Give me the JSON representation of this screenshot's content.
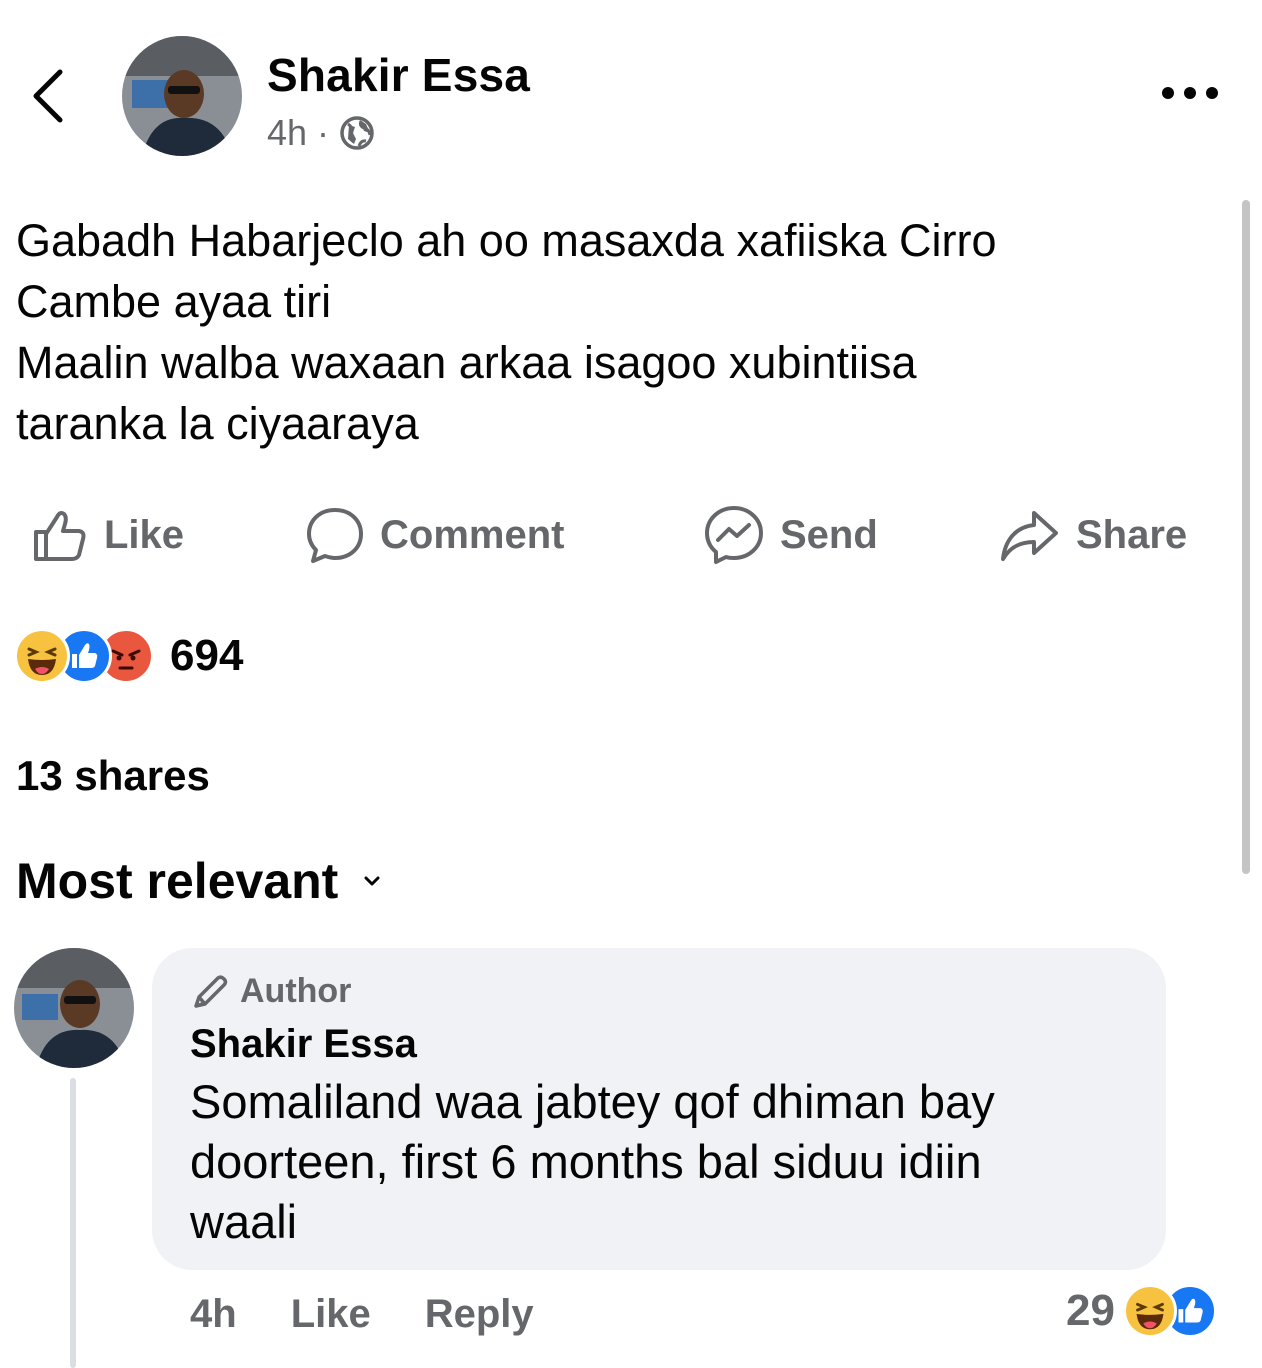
{
  "post": {
    "author": "Shakir Essa",
    "time": "4h",
    "separator": "·",
    "audience_icon": "globe-icon",
    "text_lines": [
      "Gabadh Habarjeclo ah oo masaxda xafiiska Cirro",
      "Cambe ayaa tiri",
      "Maalin walba waxaan arkaa isagoo xubintiisa",
      "taranka la ciyaaraya"
    ]
  },
  "actions": {
    "like": "Like",
    "comment": "Comment",
    "send": "Send",
    "share": "Share"
  },
  "reactions": {
    "types": [
      "haha",
      "like",
      "angry"
    ],
    "count": "694"
  },
  "shares": "13 shares",
  "sort": {
    "label": "Most relevant"
  },
  "comment": {
    "badge": "Author",
    "name": "Shakir Essa",
    "text_lines": [
      "Somaliland waa jabtey qof dhiman bay",
      "doorteen, first 6 months bal siduu idiin",
      "waali"
    ],
    "time": "4h",
    "like": "Like",
    "reply": "Reply",
    "reaction_count": "29",
    "reaction_types": [
      "haha",
      "like"
    ]
  },
  "colors": {
    "text": "#050505",
    "secondary": "#65676b",
    "bubble": "#f0f2f5",
    "like_blue": "#1877f2",
    "haha_yellow": "#f7c23f",
    "angry_red": "#e9573e"
  }
}
